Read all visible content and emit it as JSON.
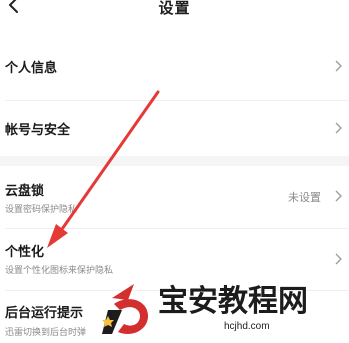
{
  "header": {
    "title": "设置",
    "back_icon": "chevron-left-icon"
  },
  "rows": {
    "personal_info": {
      "title": "个人信息"
    },
    "account_security": {
      "title": "帐号与安全"
    },
    "cloud_lock": {
      "title": "云盘锁",
      "subtitle": "设置密码保护隐私",
      "value": "未设置"
    },
    "personalize": {
      "title": "个性化",
      "subtitle": "设置个性化图标来保护隐私"
    },
    "background_hint": {
      "title": "后台运行提示",
      "subtitle": "迅雷切换到后台时弹"
    }
  },
  "annotation": {
    "arrow_color": "#e53935"
  },
  "watermark": {
    "text": "宝安教程网",
    "url": "hcjhd.com",
    "logo_color": "#d32f2f",
    "logo_icon": "wm-logo-icon"
  },
  "colors": {
    "divider": "#efefef",
    "section_bg": "#f5f5f7",
    "subtitle": "#8a8a8a"
  }
}
